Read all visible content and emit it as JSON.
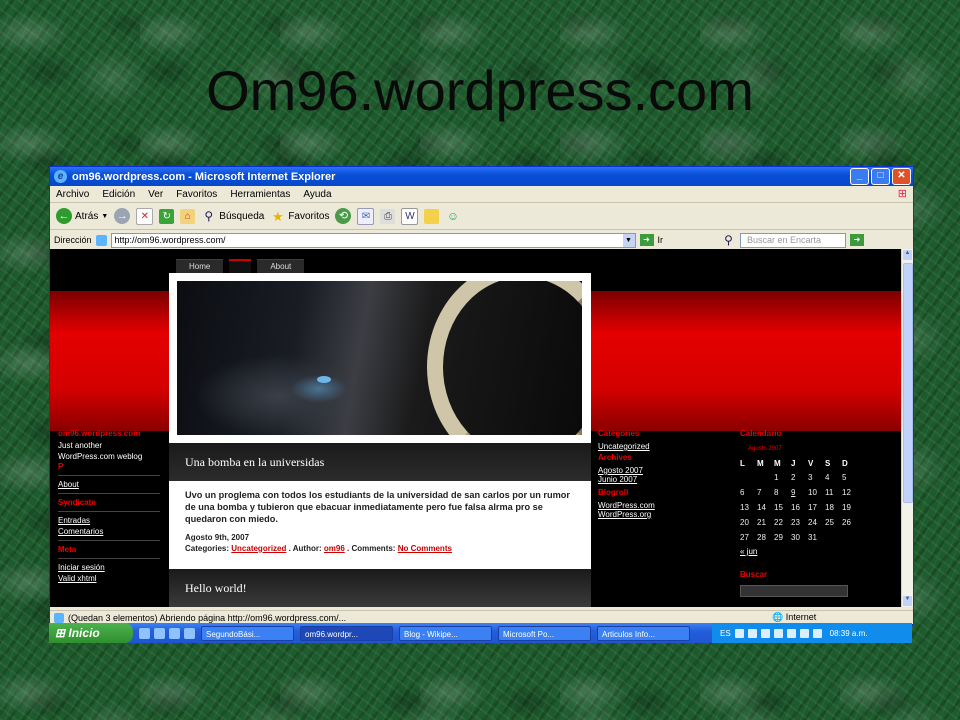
{
  "slide_title": "Om96.wordpress.com",
  "window": {
    "title": "om96.wordpress.com - Microsoft Internet Explorer",
    "buttons": [
      "_",
      "□",
      "✕"
    ]
  },
  "menu": [
    "Archivo",
    "Edición",
    "Ver",
    "Favoritos",
    "Herramientas",
    "Ayuda"
  ],
  "toolbar": {
    "back_label": "Atrás",
    "search_label": "Búsqueda",
    "favorites_label": "Favoritos"
  },
  "address": {
    "label": "Dirección",
    "url": "http://om96.wordpress.com/",
    "go_label": "Ir",
    "search_placeholder": "Buscar en Encarta"
  },
  "site": {
    "nav": [
      "Home",
      "About"
    ],
    "left": {
      "title": "om96.wordpress.com",
      "tagline": "Just another WordPress.com weblog",
      "p": "P",
      "about": "About",
      "syndicate": "Syndicate",
      "entradas": "Entradas",
      "comentarios": "Comentarios",
      "meta": "Meta",
      "login": "Iniciar sesión",
      "xhtml": "Valid xhtml"
    },
    "post1": {
      "title": "Una bomba en la universidas",
      "body": "Uvo un proglema con todos los estudiants de la universidad de san carlos por un rumor de una bomba y tubieron que ebacuar inmediatamente pero fue falsa alrma pro se quedaron con miedo.",
      "date": "Agosto 9th, 2007",
      "categories_label": "Categories:",
      "category": "Uncategorized",
      "author_label": ". Author:",
      "author": "om96",
      "comments_sep": ". Comments:",
      "comments": "No Comments"
    },
    "post2": {
      "title": "Hello world!"
    },
    "right": {
      "categories": "Categories",
      "uncategorized": "Uncategorized",
      "archives": "Archives",
      "agosto": "Agosto 2007",
      "junio": "Junio 2007",
      "blogroll": "Blogroll",
      "wp_com": "WordPress.com",
      "wp_org": "WordPress.org"
    },
    "calendar": {
      "title": "Calendario",
      "month": "Agosto 2007",
      "days": [
        "L",
        "M",
        "M",
        "J",
        "V",
        "S",
        "D"
      ],
      "weeks": [
        [
          "",
          "",
          "1",
          "2",
          "3",
          "4",
          "5"
        ],
        [
          "6",
          "7",
          "8",
          "9",
          "10",
          "11",
          "12"
        ],
        [
          "13",
          "14",
          "15",
          "16",
          "17",
          "18",
          "19"
        ],
        [
          "20",
          "21",
          "22",
          "23",
          "24",
          "25",
          "26"
        ],
        [
          "27",
          "28",
          "29",
          "30",
          "31",
          "",
          ""
        ]
      ],
      "prev": "« jun",
      "buscar": "Buscar"
    }
  },
  "status": {
    "text": "(Quedan 3 elementos) Abriendo página http://om96.wordpress.com/...",
    "zone": "Internet"
  },
  "taskbar": {
    "start": "Inicio",
    "tasks": [
      "SegundoBási...",
      "om96.wordpr...",
      "Blog - Wikipe...",
      "Microsoft Po...",
      "Articulos Info..."
    ],
    "lang": "ES",
    "clock": "08:39 a.m."
  }
}
